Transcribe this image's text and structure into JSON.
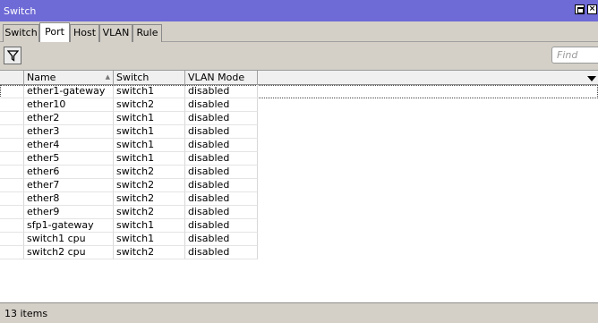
{
  "window": {
    "title": "Switch"
  },
  "tabs": [
    {
      "label": "Switch"
    },
    {
      "label": "Port",
      "active": true
    },
    {
      "label": "Host"
    },
    {
      "label": "VLAN"
    },
    {
      "label": "Rule"
    }
  ],
  "toolbar": {
    "find_placeholder": "Find",
    "filter_icon": "filter-icon"
  },
  "table": {
    "columns": [
      "Name",
      "Switch",
      "VLAN Mode"
    ],
    "rows": [
      [
        "ether1-gateway",
        "switch1",
        "disabled"
      ],
      [
        "ether10",
        "switch2",
        "disabled"
      ],
      [
        "ether2",
        "switch1",
        "disabled"
      ],
      [
        "ether3",
        "switch1",
        "disabled"
      ],
      [
        "ether4",
        "switch1",
        "disabled"
      ],
      [
        "ether5",
        "switch1",
        "disabled"
      ],
      [
        "ether6",
        "switch2",
        "disabled"
      ],
      [
        "ether7",
        "switch2",
        "disabled"
      ],
      [
        "ether8",
        "switch2",
        "disabled"
      ],
      [
        "ether9",
        "switch2",
        "disabled"
      ],
      [
        "sfp1-gateway",
        "switch1",
        "disabled"
      ],
      [
        "switch1 cpu",
        "switch1",
        "disabled"
      ],
      [
        "switch2 cpu",
        "switch2",
        "disabled"
      ]
    ]
  },
  "status": {
    "count_text": "13 items"
  },
  "colors": {
    "titlebar": "#6e6ad6",
    "chrome": "#d4d0c8"
  }
}
